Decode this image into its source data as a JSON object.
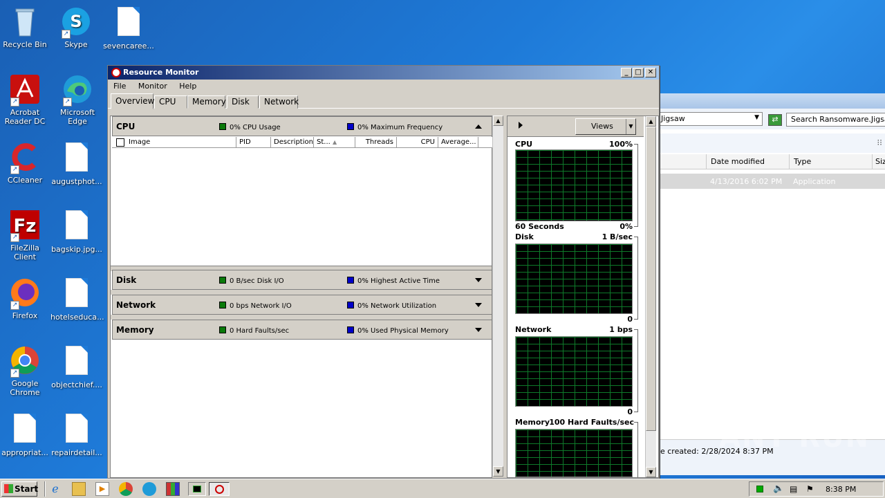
{
  "desktop": {
    "icons": [
      {
        "label": "Recycle Bin"
      },
      {
        "label": "Skype"
      },
      {
        "label": "sevencaree..."
      },
      {
        "label": "Acrobat Reader DC"
      },
      {
        "label": "Microsoft Edge"
      },
      {
        "label": "CCleaner"
      },
      {
        "label": "augustphot..."
      },
      {
        "label": "FileZilla Client"
      },
      {
        "label": "bagskip.jpg..."
      },
      {
        "label": "Firefox"
      },
      {
        "label": "hotelseduca..."
      },
      {
        "label": "Google Chrome"
      },
      {
        "label": "objectchief...."
      },
      {
        "label": "appropriat..."
      },
      {
        "label": "repairdetail..."
      }
    ]
  },
  "explorer": {
    "address": "Jigsaw",
    "search": "Search Ransomware.Jigsaw",
    "columns": {
      "date": "Date modified",
      "type": "Type",
      "size": "Size"
    },
    "row": {
      "date": "4/13/2016 6:02 PM",
      "type": "Application"
    },
    "status": "e created: 2/28/2024 8:37 PM"
  },
  "window": {
    "title": "Resource Monitor",
    "menu": [
      "File",
      "Monitor",
      "Help"
    ],
    "tabs": [
      "Overview",
      "CPU",
      "Memory",
      "Disk",
      "Network"
    ]
  },
  "sections": {
    "cpu": {
      "name": "CPU",
      "stat1": "0% CPU Usage",
      "stat2": "0% Maximum Frequency"
    },
    "disk": {
      "name": "Disk",
      "stat1": "0 B/sec Disk I/O",
      "stat2": "0% Highest Active Time"
    },
    "network": {
      "name": "Network",
      "stat1": "0 bps Network I/O",
      "stat2": "0% Network Utilization"
    },
    "memory": {
      "name": "Memory",
      "stat1": "0 Hard Faults/sec",
      "stat2": "0% Used Physical Memory"
    }
  },
  "cpu_columns": [
    "Image",
    "PID",
    "Description",
    "St...",
    "Threads",
    "CPU",
    "Average..."
  ],
  "graphs": {
    "views_label": "Views",
    "cpu": {
      "label": "CPU",
      "max": "100%",
      "foot_left": "60 Seconds",
      "foot_right": "0%"
    },
    "disk": {
      "label": "Disk",
      "max": "1 B/sec",
      "foot_right": "0"
    },
    "network": {
      "label": "Network",
      "max": "1 bps",
      "foot_right": "0"
    },
    "memory": {
      "label": "Memory",
      "max": "100 Hard Faults/sec"
    }
  },
  "taskbar": {
    "start": "Start",
    "clock": "8:38 PM"
  },
  "watermark": "ANY RUN"
}
